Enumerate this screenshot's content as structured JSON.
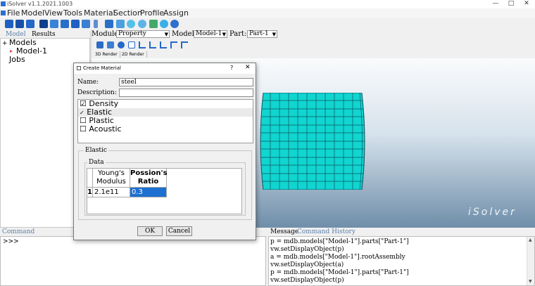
{
  "window": {
    "title": "iSolver v1.1.2021.1003",
    "minimize": "—",
    "maximize": "□",
    "close": "✕"
  },
  "menu": [
    "File",
    "Model",
    "View",
    "Tools",
    "Material",
    "Section",
    "Profile",
    "Assign"
  ],
  "left_tabs": {
    "model": "Model",
    "results": "Results"
  },
  "tree": {
    "root": "Models",
    "child": "Model-1",
    "jobs": "Jobs",
    "expander": "+"
  },
  "module_bar": {
    "module_label": "Module:",
    "module_value": "Property",
    "model_label": "Model:",
    "model_value": "Model-1",
    "part_label": "Part:",
    "part_value": "Part-1"
  },
  "view_tabs": [
    "3D Render",
    "2D Render"
  ],
  "watermark": "iSolver",
  "dialog": {
    "title": "Create Material",
    "help": "?",
    "close": "✕",
    "name_label": "Name:",
    "name_value": "steel",
    "description_label": "Description:",
    "description_value": "",
    "behaviors": [
      {
        "label": "Density",
        "mark": "☑"
      },
      {
        "label": "Elastic",
        "mark": "✓"
      },
      {
        "label": "Plastic",
        "mark": "☐"
      },
      {
        "label": "Acoustic",
        "mark": "☐"
      }
    ],
    "section_title": "Elastic",
    "data_title": "Data",
    "table": {
      "columns": [
        "Young's Modulus",
        "Possion's Ratio"
      ],
      "row_number": "1",
      "values": [
        "2.1e11",
        "0.3"
      ]
    },
    "ok": "OK",
    "cancel": "Cancel"
  },
  "command": {
    "label": "Command",
    "prompt": ">>>"
  },
  "message": {
    "tab_message": "Message",
    "tab_history": "Command History",
    "lines": [
      "p = mdb.models[\"Model-1\"].parts[\"Part-1\"]",
      "vw.setDisplayObject(p)",
      "a = mdb.models[\"Model-1\"].rootAssembly",
      "vw.setDisplayObject(a)",
      "p = mdb.models[\"Model-1\"].parts[\"Part-1\"]",
      "vw.setDisplayObject(p)"
    ]
  },
  "colors": {
    "accent": "#1e70d0",
    "mesh_fill": "#11d5d0",
    "mesh_line": "#0a5560",
    "link": "#5c7fa8"
  }
}
